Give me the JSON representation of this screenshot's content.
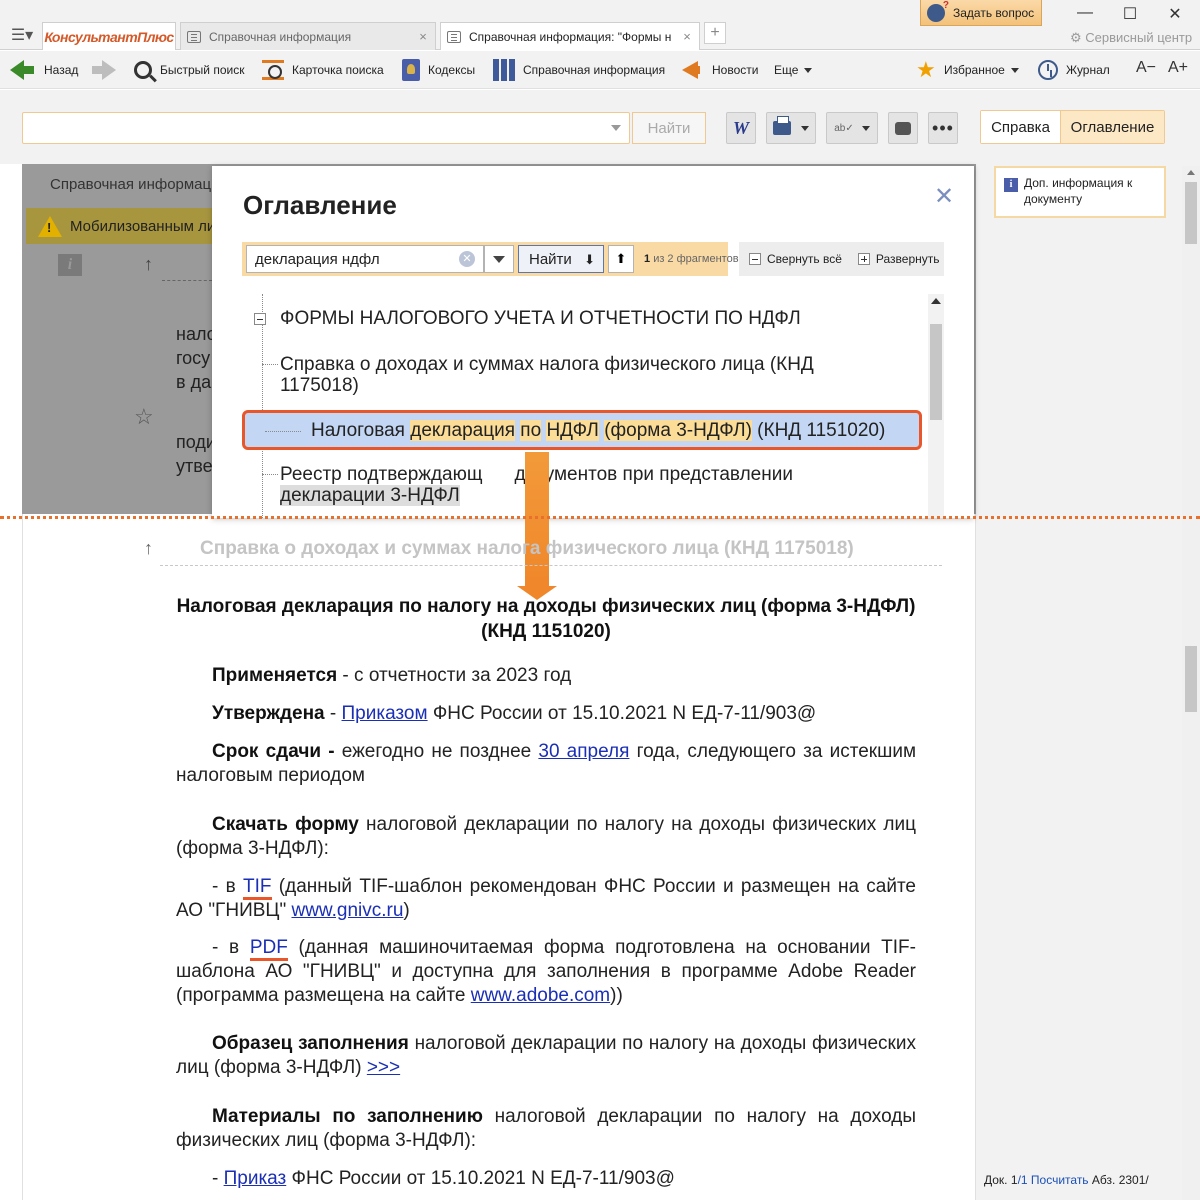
{
  "titlebar": {
    "logo": "КонсультантПлюс",
    "tabs": [
      {
        "label": "Справочная информация"
      },
      {
        "label": "Справочная информация: \"Формы н"
      }
    ],
    "ask_button": "Задать вопрос",
    "service_center": "Сервисный центр",
    "close_glyph": "×",
    "new_tab_glyph": "+"
  },
  "toolbar": {
    "back": "Назад",
    "quick_search": "Быстрый поиск",
    "search_card": "Карточка поиска",
    "codexes": "Кодексы",
    "reference_info": "Справочная информация",
    "news": "Новости",
    "more": "Еще",
    "favorites": "Избранное",
    "journal": "Журнал",
    "font_smaller": "A−",
    "font_larger": "A+"
  },
  "search_row": {
    "search_value": "",
    "find_button": "Найти",
    "w_button": "W",
    "more_button": "•••",
    "right_tabs": [
      "Справка",
      "Оглавление"
    ]
  },
  "right_panel": {
    "doc_info": "Доп. информация к документу",
    "status": {
      "doc_label": "Док.",
      "doc_current": "1",
      "doc_total": "/1",
      "count_link": "Посчитать",
      "abz": "Абз. 2301/"
    }
  },
  "background_doc": {
    "tab_label": "Справочная информаци",
    "mobilized": "Мобилизованным ли",
    "fragments": [
      "нало",
      "госу",
      "в да",
      "поди",
      "утве"
    ]
  },
  "toc": {
    "title": "Оглавление",
    "search_value": "декларация ндфл",
    "find_button": "Найти",
    "count_current": "1",
    "count_rest": "из 2 фрагментов",
    "collapse_all": "Свернуть всё",
    "expand": "Развернуть",
    "root": "ФОРМЫ НАЛОГОВОГО УЧЕТА И ОТЧЕТНОСТИ ПО НДФЛ",
    "items": [
      {
        "text": "Справка о доходах и суммах налога физического лица (КНД 1175018)"
      },
      {
        "text": "Налоговая декларация по НДФЛ (форма 3-НДФЛ) (КНД 1151020)",
        "parts": [
          "Налоговая ",
          "декларация",
          " ",
          "по",
          " ",
          "НДФЛ",
          " ",
          "(форма 3-",
          "НДФЛ",
          ")",
          " (КНД 1151020)"
        ]
      },
      {
        "text": "Реестр подтверждающих документов при представлении декларации 3-НДФЛ",
        "line1": "Реестр подтверждающ",
        "line1b": "документов при представлении",
        "line2a": "декларации",
        "line2b": " 3-НДФЛ"
      }
    ]
  },
  "document": {
    "prev_title": "Справка о доходах и суммах налога физического лица (КНД 1175018)",
    "heading": "Налоговая декларация по налогу на доходы физических лиц (форма 3-НДФЛ) (КНД 1151020)",
    "applies_label": "Применяется",
    "applies_text": " - с отчетности за 2023 год",
    "approved_label": "Утверждена",
    "approved_dash": " - ",
    "approved_link": "Приказом",
    "approved_text": " ФНС России от 15.10.2021 N ЕД-7-11/903@",
    "deadline_label": "Срок сдачи -",
    "deadline_text1": " ежегодно не позднее ",
    "deadline_link": "30 апреля",
    "deadline_text2": " года, следующего за истекшим налоговым периодом",
    "download_label": "Скачать форму",
    "download_text": " налоговой декларации по налогу на доходы физических лиц (форма 3-НДФЛ):",
    "tif_prefix": "- в ",
    "tif_link": "TIF",
    "tif_text": " (данный TIF-шаблон рекомендован ФНС России и размещен на сайте АО \"ГНИВЦ\" ",
    "tif_site": "www.gnivc.ru",
    "tif_close": ")",
    "pdf_prefix": "- в ",
    "pdf_link": "PDF",
    "pdf_text": " (данная машиночитаемая форма подготовлена на основании TIF-шаблона АО \"ГНИВЦ\" и доступна для заполнения в программе Adobe Reader (программа размещена на сайте ",
    "pdf_site": "www.adobe.com",
    "pdf_close": "))",
    "sample_label": "Образец заполнения",
    "sample_text": " налоговой декларации по налогу на доходы физических лиц (форма 3-НДФЛ) ",
    "sample_link": ">>>",
    "materials_label": "Материалы по заполнению",
    "materials_text": " налоговой декларации по налогу на доходы физических лиц (форма 3-НДФЛ):",
    "order_prefix": "- ",
    "order_link": "Приказ",
    "order_text": " ФНС России от 15.10.2021 N ЕД-7-11/903@"
  },
  "colors": {
    "accent": "#e8562a",
    "toolbar_bg": "#f2f2f2",
    "highlight": "#fbdd98",
    "selection": "#c3d6f3",
    "link": "#1a2fb5"
  }
}
